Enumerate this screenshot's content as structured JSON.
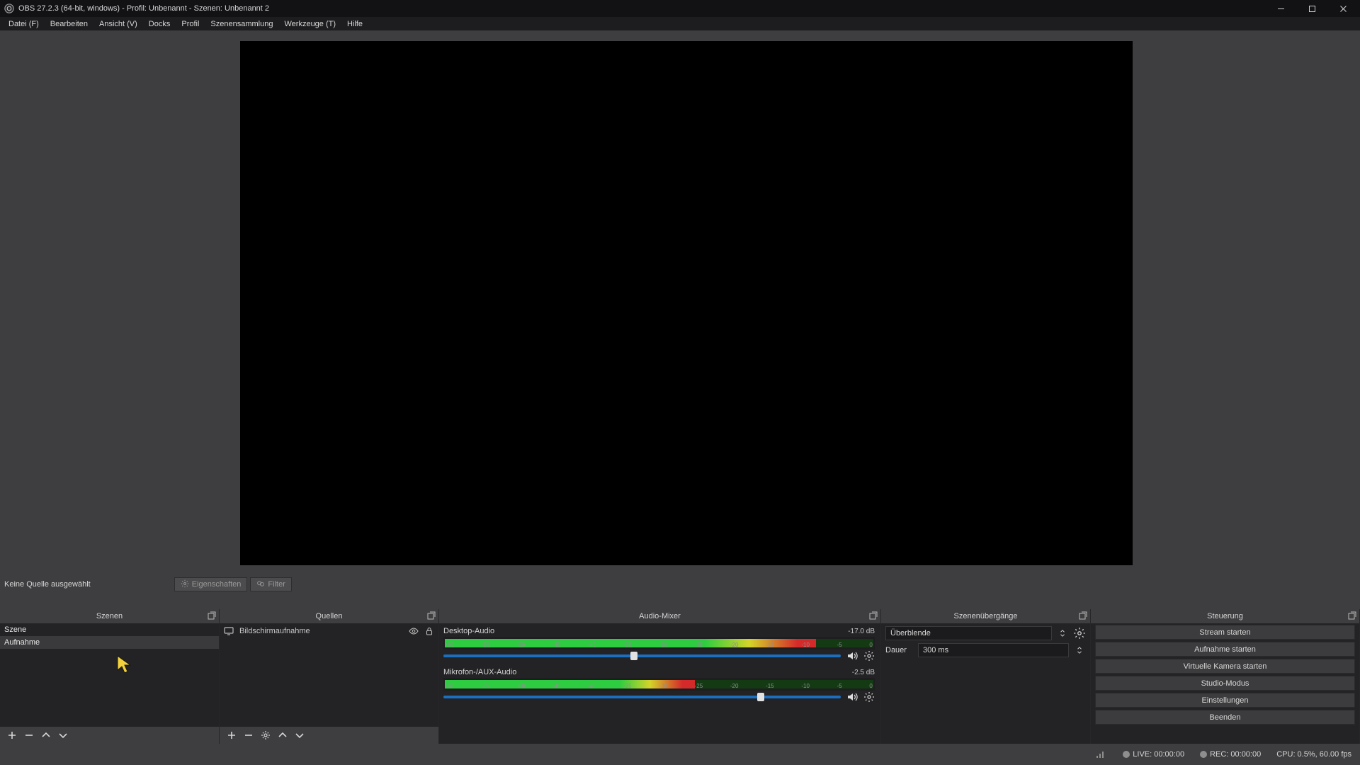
{
  "title": "OBS 27.2.3 (64-bit, windows) - Profil: Unbenannt - Szenen: Unbenannt 2",
  "menu": [
    "Datei (F)",
    "Bearbeiten",
    "Ansicht (V)",
    "Docks",
    "Profil",
    "Szenensammlung",
    "Werkzeuge (T)",
    "Hilfe"
  ],
  "infobar": {
    "no_source": "Keine Quelle ausgewählt",
    "properties": "Eigenschaften",
    "filters": "Filter"
  },
  "docks": {
    "scenes": {
      "title": "Szenen",
      "items": [
        "Szene",
        "Aufnahme"
      ]
    },
    "sources": {
      "title": "Quellen",
      "items": [
        {
          "name": "Bildschirmaufnahme"
        }
      ]
    },
    "mixer": {
      "title": "Audio-Mixer",
      "channels": [
        {
          "name": "Desktop-Audio",
          "db": "-17.0 dB",
          "level_pct": 86,
          "slider_pct": 47
        },
        {
          "name": "Mikrofon-/AUX-Audio",
          "db": "-2.5 dB",
          "level_pct": 58,
          "slider_pct": 79
        }
      ],
      "scale": [
        "-60",
        "-55",
        "-50",
        "-45",
        "-40",
        "-35",
        "-30",
        "-25",
        "-20",
        "-15",
        "-10",
        "-5",
        "0"
      ]
    },
    "transitions": {
      "title": "Szenenübergänge",
      "selected": "Überblende",
      "duration_label": "Dauer",
      "duration_value": "300 ms"
    },
    "controls": {
      "title": "Steuerung",
      "buttons": [
        "Stream starten",
        "Aufnahme starten",
        "Virtuelle Kamera starten",
        "Studio-Modus",
        "Einstellungen",
        "Beenden"
      ]
    }
  },
  "status": {
    "live": "LIVE: 00:00:00",
    "rec": "REC: 00:00:00",
    "cpu": "CPU: 0.5%, 60.00 fps"
  }
}
